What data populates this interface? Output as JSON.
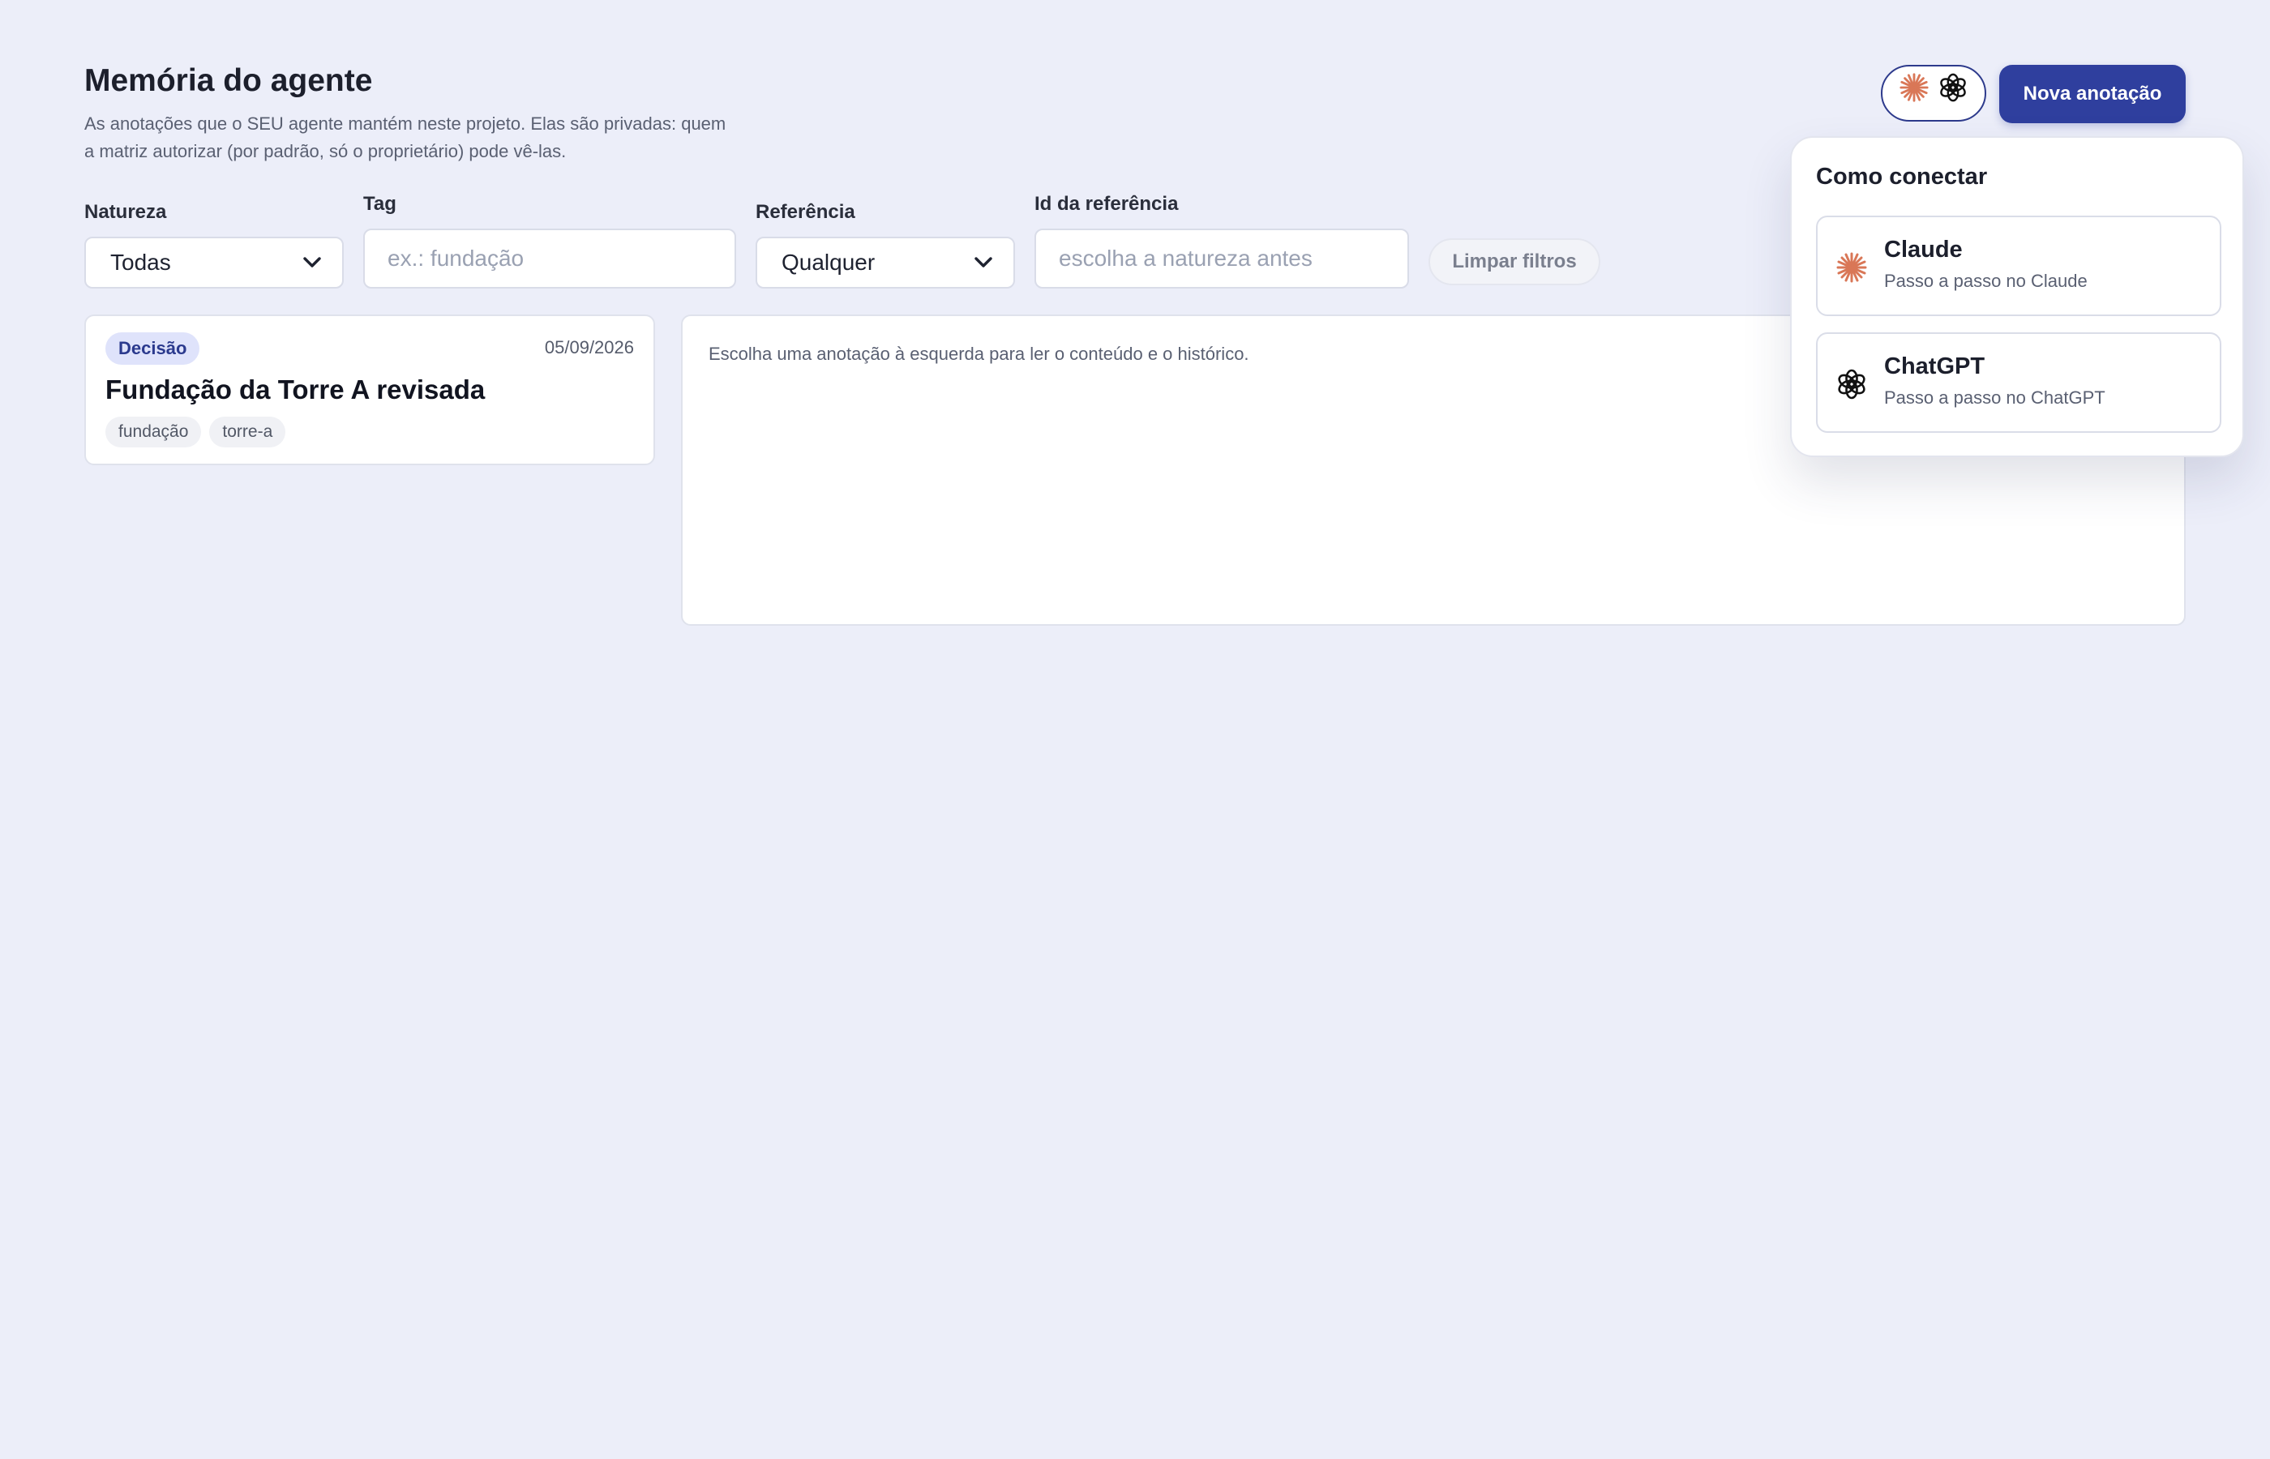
{
  "header": {
    "title": "Memória do agente",
    "subtitle": "As anotações que o SEU agente mantém neste projeto. Elas são privadas: quem a matriz autorizar (por padrão, só o proprietário) pode vê-las.",
    "new_note_label": "Nova anotação",
    "connect_icons": [
      "claude-icon",
      "chatgpt-icon"
    ]
  },
  "filters": {
    "nature_label": "Natureza",
    "nature_value": "Todas",
    "tag_label": "Tag",
    "tag_placeholder": "ex.: fundação",
    "reference_label": "Referência",
    "reference_value": "Qualquer",
    "reference_id_label": "Id da referência",
    "reference_id_placeholder": "escolha a natureza antes",
    "clear_label": "Limpar filtros"
  },
  "notes": [
    {
      "nature": "Decisão",
      "date": "05/09/2026",
      "title": "Fundação da Torre A revisada",
      "tags": [
        "fundação",
        "torre-a"
      ]
    }
  ],
  "detail": {
    "hint": "Escolha uma anotação à esquerda para ler o conteúdo e o histórico."
  },
  "popover": {
    "title": "Como conectar",
    "providers": [
      {
        "name": "Claude",
        "subtitle": "Passo a passo no Claude",
        "icon": "claude-icon"
      },
      {
        "name": "ChatGPT",
        "subtitle": "Passo a passo no ChatGPT",
        "icon": "chatgpt-icon"
      }
    ]
  },
  "colors": {
    "background": "#eceef9",
    "accent": "#2f3f9e",
    "claude": "#d97757",
    "badge_bg": "#dfe3fb"
  }
}
